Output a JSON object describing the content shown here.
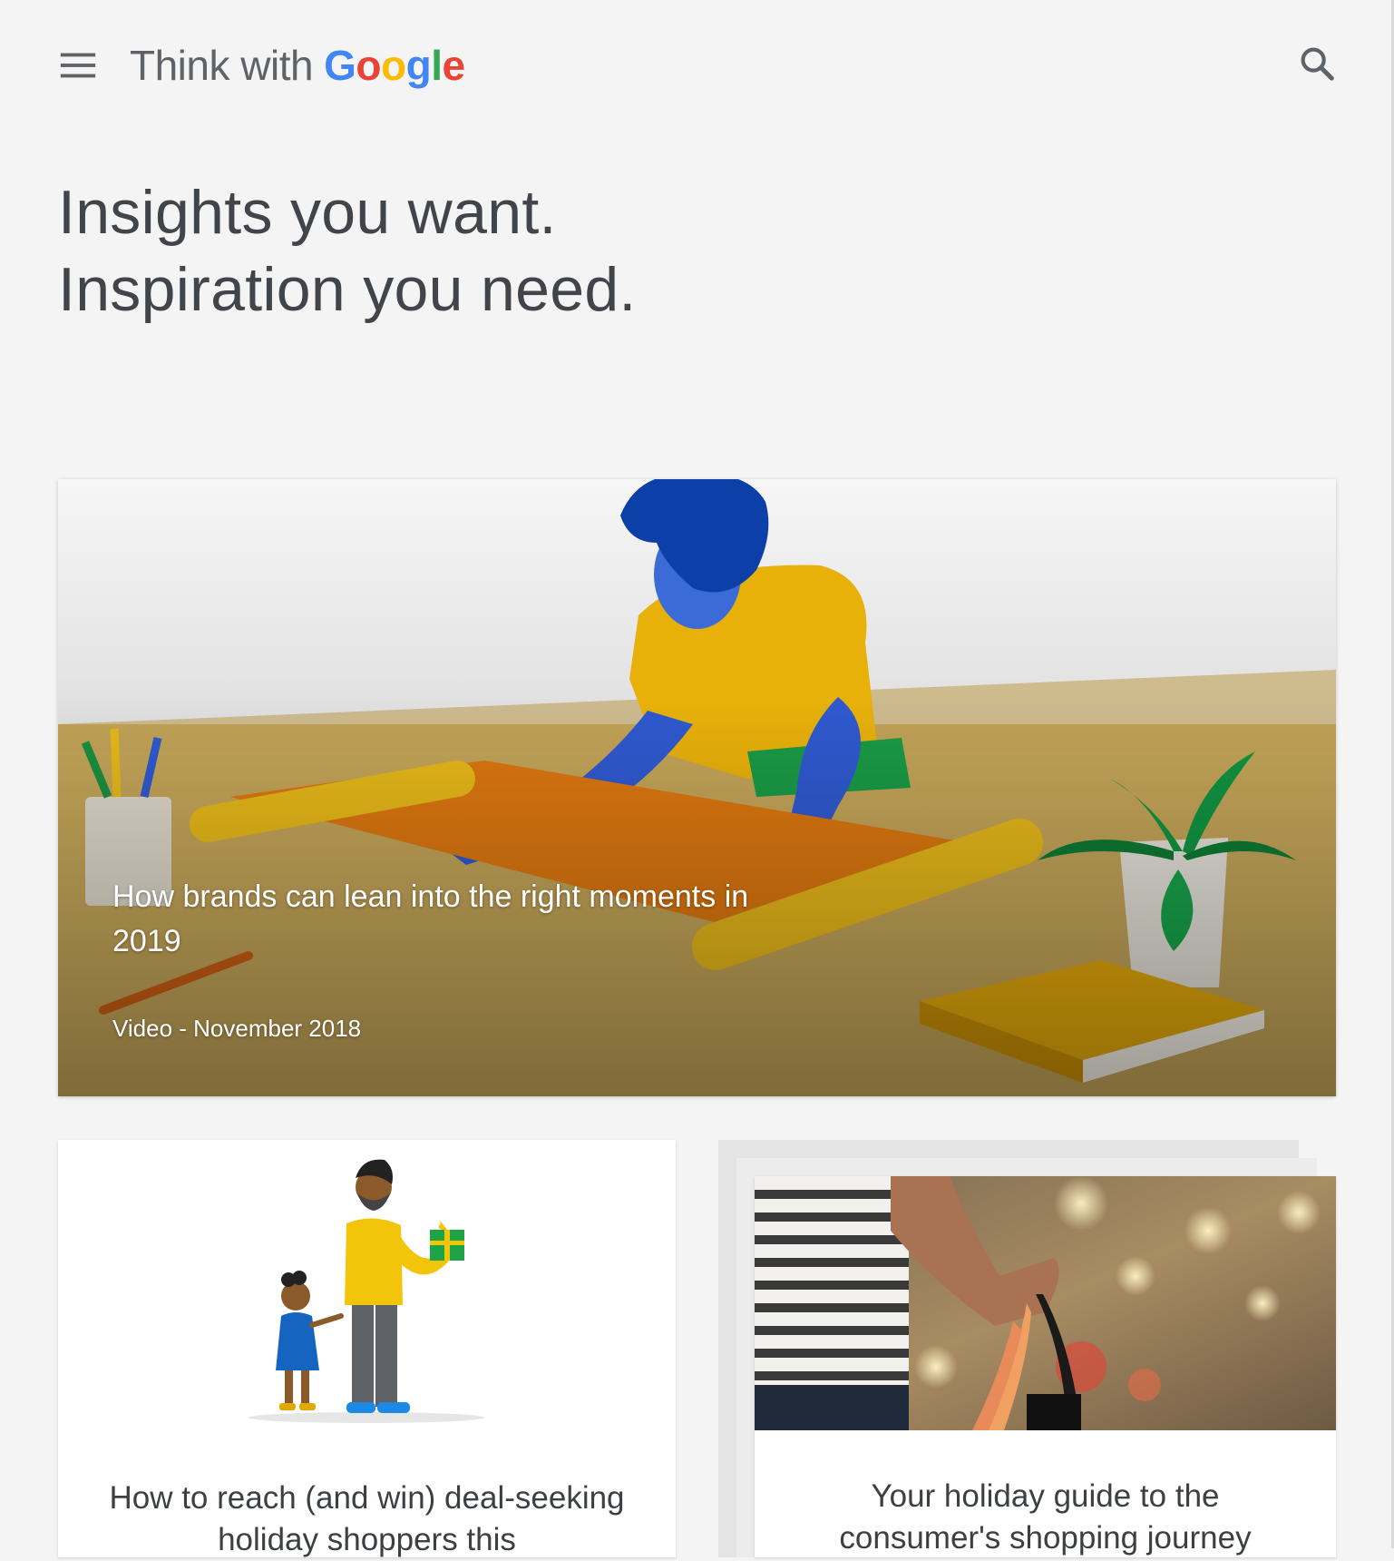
{
  "header": {
    "brand_prefix": "Think with",
    "brand_name": "Google",
    "menu_icon": "hamburger-menu-icon",
    "search_icon": "search-icon",
    "brand_colors": [
      "#4285F4",
      "#EA4335",
      "#FBBC05",
      "#4285F4",
      "#34A853",
      "#EA4335"
    ]
  },
  "hero": {
    "line1": "Insights you want.",
    "line2": "Inspiration you need."
  },
  "featured": {
    "title": "How brands can lean into the right moments in 2019",
    "meta": "Video - November 2018"
  },
  "cards": [
    {
      "title": "How to reach (and win) deal-seeking holiday shoppers this"
    },
    {
      "title": "Your holiday guide to the consumer's shopping journey"
    }
  ]
}
